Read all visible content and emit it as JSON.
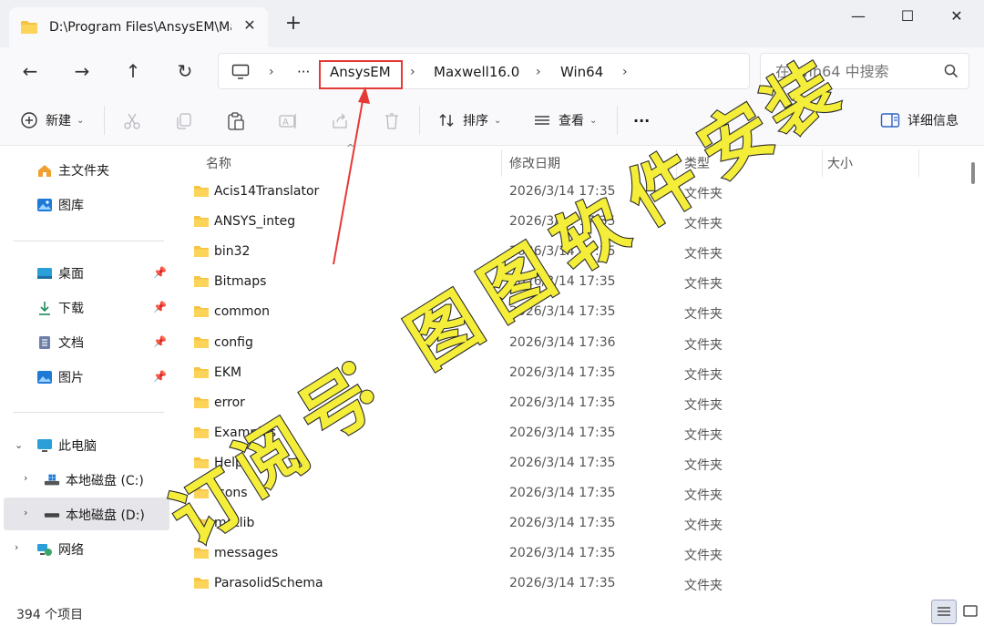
{
  "titlebar": {
    "tab_title": "D:\\Program Files\\AnsysEM\\Ma",
    "tab_close": "✕",
    "new_tab": "+",
    "minimize": "—",
    "maximize": "☐",
    "close": "✕"
  },
  "nav": {
    "back": "←",
    "forward": "→",
    "up": "↑",
    "refresh": "↻",
    "breadcrumb": {
      "overflow": "···",
      "items": [
        "AnsysEM",
        "Maxwell16.0",
        "Win64"
      ],
      "sep": "›"
    },
    "search_placeholder": "在 Win64 中搜索"
  },
  "commands": {
    "new_label": "新建",
    "sort_label": "排序",
    "view_label": "查看",
    "more_label": "···",
    "details_label": "详细信息"
  },
  "sidebar": {
    "home": "主文件夹",
    "gallery": "图库",
    "desktop": "桌面",
    "downloads": "下载",
    "documents": "文档",
    "pictures": "图片",
    "this_pc": "此电脑",
    "drive_c": "本地磁盘 (C:)",
    "drive_d": "本地磁盘 (D:)",
    "network": "网络",
    "pin_icon": "📌"
  },
  "columns": {
    "name": "名称",
    "date": "修改日期",
    "type": "类型",
    "size": "大小"
  },
  "files": [
    {
      "name": "Acis14Translator",
      "date": "2026/3/14 17:35",
      "type": "文件夹"
    },
    {
      "name": "ANSYS_integ",
      "date": "2026/3/14 17:35",
      "type": "文件夹"
    },
    {
      "name": "bin32",
      "date": "2026/3/14 17:35",
      "type": "文件夹"
    },
    {
      "name": "Bitmaps",
      "date": "2026/3/14 17:35",
      "type": "文件夹"
    },
    {
      "name": "common",
      "date": "2026/3/14 17:35",
      "type": "文件夹"
    },
    {
      "name": "config",
      "date": "2026/3/14 17:36",
      "type": "文件夹"
    },
    {
      "name": "EKM",
      "date": "2026/3/14 17:35",
      "type": "文件夹"
    },
    {
      "name": "error",
      "date": "2026/3/14 17:35",
      "type": "文件夹"
    },
    {
      "name": "Examples",
      "date": "2026/3/14 17:35",
      "type": "文件夹"
    },
    {
      "name": "Help",
      "date": "2026/3/14 17:35",
      "type": "文件夹"
    },
    {
      "name": "Icons",
      "date": "2026/3/14 17:35",
      "type": "文件夹"
    },
    {
      "name": "matlib",
      "date": "2026/3/14 17:35",
      "type": "文件夹"
    },
    {
      "name": "messages",
      "date": "2026/3/14 17:35",
      "type": "文件夹"
    },
    {
      "name": "ParasolidSchema",
      "date": "2026/3/14 17:35",
      "type": "文件夹"
    }
  ],
  "status": {
    "item_count": "394 个项目"
  },
  "watermark": {
    "text": "图图软件安装"
  },
  "colors": {
    "folder": "#f6c443",
    "highlight_box": "#e53935",
    "watermark_fill": "#f4ee3a",
    "watermark_stroke": "#2a2a2a"
  }
}
